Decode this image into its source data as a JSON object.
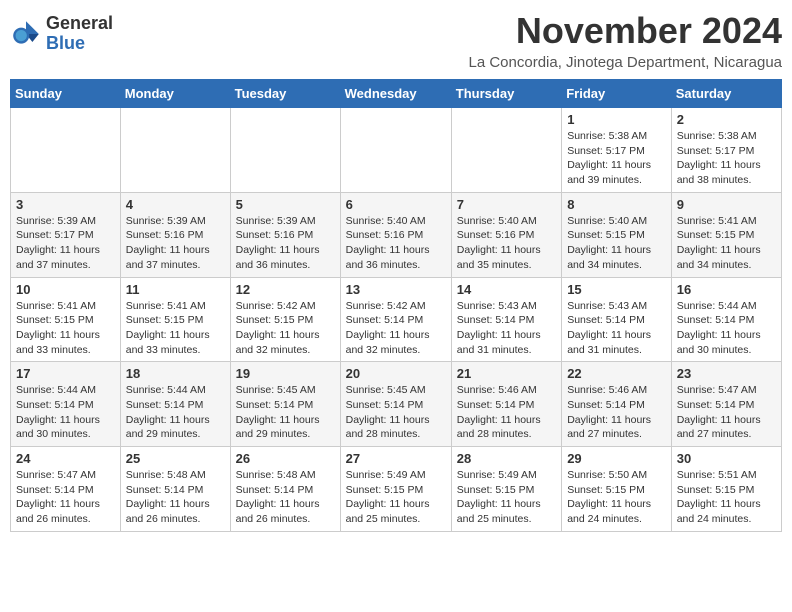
{
  "logo": {
    "general": "General",
    "blue": "Blue"
  },
  "title": "November 2024",
  "location": "La Concordia, Jinotega Department, Nicaragua",
  "days_of_week": [
    "Sunday",
    "Monday",
    "Tuesday",
    "Wednesday",
    "Thursday",
    "Friday",
    "Saturday"
  ],
  "weeks": [
    [
      {
        "day": "",
        "info": ""
      },
      {
        "day": "",
        "info": ""
      },
      {
        "day": "",
        "info": ""
      },
      {
        "day": "",
        "info": ""
      },
      {
        "day": "",
        "info": ""
      },
      {
        "day": "1",
        "info": "Sunrise: 5:38 AM\nSunset: 5:17 PM\nDaylight: 11 hours and 39 minutes."
      },
      {
        "day": "2",
        "info": "Sunrise: 5:38 AM\nSunset: 5:17 PM\nDaylight: 11 hours and 38 minutes."
      }
    ],
    [
      {
        "day": "3",
        "info": "Sunrise: 5:39 AM\nSunset: 5:17 PM\nDaylight: 11 hours and 37 minutes."
      },
      {
        "day": "4",
        "info": "Sunrise: 5:39 AM\nSunset: 5:16 PM\nDaylight: 11 hours and 37 minutes."
      },
      {
        "day": "5",
        "info": "Sunrise: 5:39 AM\nSunset: 5:16 PM\nDaylight: 11 hours and 36 minutes."
      },
      {
        "day": "6",
        "info": "Sunrise: 5:40 AM\nSunset: 5:16 PM\nDaylight: 11 hours and 36 minutes."
      },
      {
        "day": "7",
        "info": "Sunrise: 5:40 AM\nSunset: 5:16 PM\nDaylight: 11 hours and 35 minutes."
      },
      {
        "day": "8",
        "info": "Sunrise: 5:40 AM\nSunset: 5:15 PM\nDaylight: 11 hours and 34 minutes."
      },
      {
        "day": "9",
        "info": "Sunrise: 5:41 AM\nSunset: 5:15 PM\nDaylight: 11 hours and 34 minutes."
      }
    ],
    [
      {
        "day": "10",
        "info": "Sunrise: 5:41 AM\nSunset: 5:15 PM\nDaylight: 11 hours and 33 minutes."
      },
      {
        "day": "11",
        "info": "Sunrise: 5:41 AM\nSunset: 5:15 PM\nDaylight: 11 hours and 33 minutes."
      },
      {
        "day": "12",
        "info": "Sunrise: 5:42 AM\nSunset: 5:15 PM\nDaylight: 11 hours and 32 minutes."
      },
      {
        "day": "13",
        "info": "Sunrise: 5:42 AM\nSunset: 5:14 PM\nDaylight: 11 hours and 32 minutes."
      },
      {
        "day": "14",
        "info": "Sunrise: 5:43 AM\nSunset: 5:14 PM\nDaylight: 11 hours and 31 minutes."
      },
      {
        "day": "15",
        "info": "Sunrise: 5:43 AM\nSunset: 5:14 PM\nDaylight: 11 hours and 31 minutes."
      },
      {
        "day": "16",
        "info": "Sunrise: 5:44 AM\nSunset: 5:14 PM\nDaylight: 11 hours and 30 minutes."
      }
    ],
    [
      {
        "day": "17",
        "info": "Sunrise: 5:44 AM\nSunset: 5:14 PM\nDaylight: 11 hours and 30 minutes."
      },
      {
        "day": "18",
        "info": "Sunrise: 5:44 AM\nSunset: 5:14 PM\nDaylight: 11 hours and 29 minutes."
      },
      {
        "day": "19",
        "info": "Sunrise: 5:45 AM\nSunset: 5:14 PM\nDaylight: 11 hours and 29 minutes."
      },
      {
        "day": "20",
        "info": "Sunrise: 5:45 AM\nSunset: 5:14 PM\nDaylight: 11 hours and 28 minutes."
      },
      {
        "day": "21",
        "info": "Sunrise: 5:46 AM\nSunset: 5:14 PM\nDaylight: 11 hours and 28 minutes."
      },
      {
        "day": "22",
        "info": "Sunrise: 5:46 AM\nSunset: 5:14 PM\nDaylight: 11 hours and 27 minutes."
      },
      {
        "day": "23",
        "info": "Sunrise: 5:47 AM\nSunset: 5:14 PM\nDaylight: 11 hours and 27 minutes."
      }
    ],
    [
      {
        "day": "24",
        "info": "Sunrise: 5:47 AM\nSunset: 5:14 PM\nDaylight: 11 hours and 26 minutes."
      },
      {
        "day": "25",
        "info": "Sunrise: 5:48 AM\nSunset: 5:14 PM\nDaylight: 11 hours and 26 minutes."
      },
      {
        "day": "26",
        "info": "Sunrise: 5:48 AM\nSunset: 5:14 PM\nDaylight: 11 hours and 26 minutes."
      },
      {
        "day": "27",
        "info": "Sunrise: 5:49 AM\nSunset: 5:15 PM\nDaylight: 11 hours and 25 minutes."
      },
      {
        "day": "28",
        "info": "Sunrise: 5:49 AM\nSunset: 5:15 PM\nDaylight: 11 hours and 25 minutes."
      },
      {
        "day": "29",
        "info": "Sunrise: 5:50 AM\nSunset: 5:15 PM\nDaylight: 11 hours and 24 minutes."
      },
      {
        "day": "30",
        "info": "Sunrise: 5:51 AM\nSunset: 5:15 PM\nDaylight: 11 hours and 24 minutes."
      }
    ]
  ]
}
